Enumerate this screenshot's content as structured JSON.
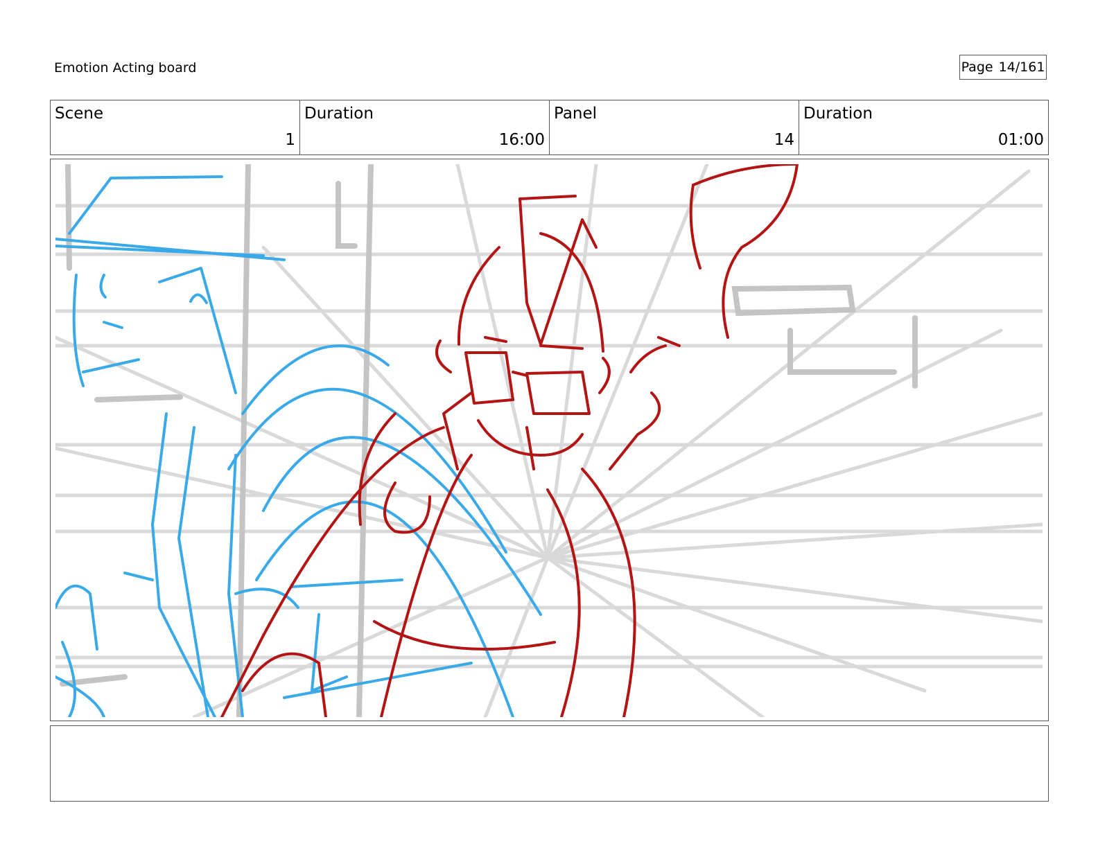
{
  "header": {
    "title": "Emotion Acting board",
    "page_label": "Page",
    "page_value": "14/161"
  },
  "info": {
    "scene_label": "Scene",
    "scene_value": "1",
    "duration_label": "Duration",
    "duration_value": "16:00",
    "panel_label": "Panel",
    "panel_value": "14",
    "panel_duration_label": "Duration",
    "panel_duration_value": "01:00"
  },
  "sketch": {
    "guide_color": "#d9d9d9",
    "blue_color": "#39a9e8",
    "red_color": "#b31414"
  },
  "notes": {
    "text": ""
  }
}
